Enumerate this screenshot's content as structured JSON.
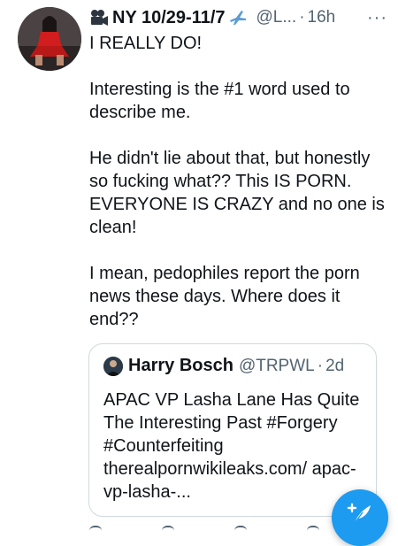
{
  "tweet": {
    "author_name": "NY 10/29-11/7",
    "author_icons": [
      "movie-camera-icon",
      "airplane-icon"
    ],
    "handle": "@L...",
    "separator": "·",
    "time": "16h",
    "more_label": "···",
    "paragraphs": [
      "I REALLY DO!",
      "Interesting is the #1 word used to describe me.",
      "He didn't lie about that, but honestly so fucking what?? This IS PORN. EVERYONE IS CRAZY and no one is clean!",
      "I mean, pedophiles report the porn news these days. Where does it end??"
    ]
  },
  "quote": {
    "author_name": "Harry Bosch",
    "handle": "@TRPWL",
    "separator": "·",
    "time": "2d",
    "text": "APAC VP Lasha Lane Has Quite The Interesting Past #Forgery #Counterfeiting therealpornwikileaks.com/ apac-vp-lasha-..."
  },
  "compose": {
    "icon": "feather-plus-icon",
    "color": "#1d9bf0"
  },
  "colors": {
    "text": "#0f1419",
    "secondary": "#536471",
    "border": "#cfd9de",
    "accent": "#1d9bf0"
  }
}
